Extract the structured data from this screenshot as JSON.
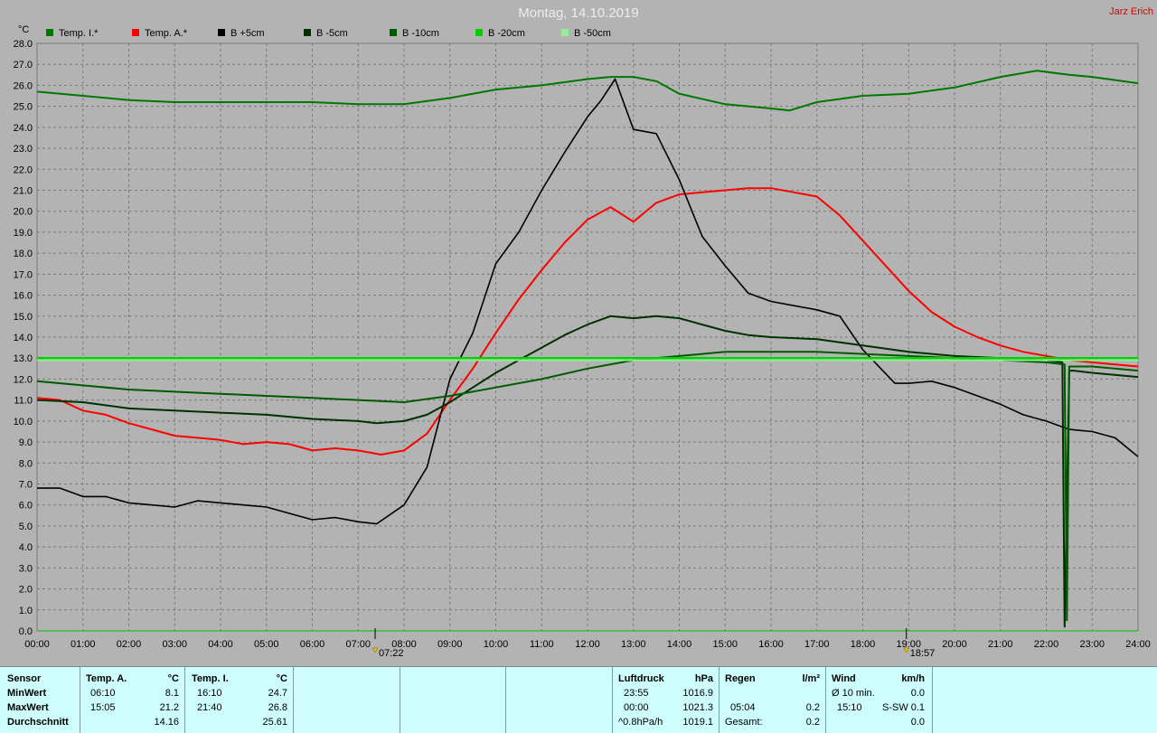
{
  "header": {
    "title": "Montag, 14.10.2019",
    "author": "Jarz Erich"
  },
  "colors": {
    "background": "#b3b3b3",
    "grid": "#7a7a7a",
    "panel": "#cdfdfd"
  },
  "legend": [
    {
      "label": "Temp. I.*",
      "color": "#007800"
    },
    {
      "label": "Temp. A.*",
      "color": "#ff0000"
    },
    {
      "label": "B +5cm",
      "color": "#000000"
    },
    {
      "label": "B -5cm",
      "color": "#003000"
    },
    {
      "label": "B -10cm",
      "color": "#005a00"
    },
    {
      "label": "B -20cm",
      "color": "#00d000"
    },
    {
      "label": "B -50cm",
      "color": "#90f090"
    }
  ],
  "chart_data": {
    "type": "line",
    "title": "Montag, 14.10.2019",
    "ylabel": "°C",
    "ylim": [
      0,
      28
    ],
    "yticks": [
      "0.0",
      "1.0",
      "2.0",
      "3.0",
      "4.0",
      "5.0",
      "6.0",
      "7.0",
      "8.0",
      "9.0",
      "10.0",
      "11.0",
      "12.0",
      "13.0",
      "14.0",
      "15.0",
      "16.0",
      "17.0",
      "18.0",
      "19.0",
      "20.0",
      "21.0",
      "22.0",
      "23.0",
      "24.0",
      "25.0",
      "26.0",
      "27.0",
      "28.0"
    ],
    "xlim": [
      0,
      24
    ],
    "xticks": [
      "00:00",
      "01:00",
      "02:00",
      "03:00",
      "04:00",
      "05:00",
      "06:00",
      "07:00",
      "08:00",
      "09:00",
      "10:00",
      "11:00",
      "12:00",
      "13:00",
      "14:00",
      "15:00",
      "16:00",
      "17:00",
      "18:00",
      "19:00",
      "20:00",
      "21:00",
      "22:00",
      "23:00",
      "24:00"
    ],
    "grid": true,
    "legend_position": "top-left",
    "markers": [
      {
        "x": 7.37,
        "label": "07:22"
      },
      {
        "x": 18.95,
        "label": "18:57"
      }
    ],
    "series": [
      {
        "name": "Temp. I.*",
        "color": "#007800",
        "x": [
          0,
          1,
          2,
          3,
          4,
          5,
          6,
          7,
          8,
          9,
          10,
          11,
          12,
          12.5,
          13,
          13.5,
          14,
          15,
          16,
          16.4,
          17,
          18,
          19,
          20,
          21,
          21.8,
          22.5,
          23,
          24
        ],
        "y": [
          25.7,
          25.5,
          25.3,
          25.2,
          25.2,
          25.2,
          25.2,
          25.1,
          25.1,
          25.4,
          25.8,
          26.0,
          26.3,
          26.4,
          26.4,
          26.2,
          25.6,
          25.1,
          24.9,
          24.8,
          25.2,
          25.5,
          25.6,
          25.9,
          26.4,
          26.7,
          26.5,
          26.4,
          26.1
        ]
      },
      {
        "name": "Temp. A.*",
        "color": "#ff0000",
        "x": [
          0,
          0.5,
          1,
          1.5,
          2,
          2.5,
          3,
          3.5,
          4,
          4.5,
          5,
          5.5,
          6,
          6.5,
          7,
          7.5,
          8,
          8.5,
          9,
          9.5,
          10,
          10.5,
          11,
          11.5,
          12,
          12.5,
          13,
          13.5,
          14,
          14.5,
          15,
          15.5,
          16,
          16.5,
          17,
          17.5,
          18,
          18.5,
          19,
          19.5,
          20,
          20.5,
          21,
          21.5,
          22,
          22.5,
          23,
          23.5,
          24
        ],
        "y": [
          11.1,
          11.0,
          10.5,
          10.3,
          9.9,
          9.6,
          9.3,
          9.2,
          9.1,
          8.9,
          9.0,
          8.9,
          8.6,
          8.7,
          8.6,
          8.4,
          8.6,
          9.4,
          11.0,
          12.5,
          14.2,
          15.8,
          17.2,
          18.5,
          19.6,
          20.2,
          19.5,
          20.4,
          20.8,
          20.9,
          21.0,
          21.1,
          21.1,
          20.9,
          20.7,
          19.8,
          18.6,
          17.4,
          16.2,
          15.2,
          14.5,
          14.0,
          13.6,
          13.3,
          13.1,
          12.9,
          12.8,
          12.7,
          12.6
        ]
      },
      {
        "name": "B +5cm",
        "color": "#000000",
        "x": [
          0,
          0.5,
          1,
          1.5,
          2,
          2.5,
          3,
          3.5,
          4,
          4.5,
          5,
          5.5,
          6,
          6.5,
          7,
          7.4,
          8,
          8.5,
          9,
          9.5,
          10,
          10.5,
          11,
          11.5,
          12,
          12.3,
          12.6,
          13,
          13.5,
          14,
          14.5,
          15,
          15.5,
          16,
          16.5,
          17,
          17.5,
          18,
          18.7,
          19,
          19.5,
          20,
          20.5,
          21,
          21.5,
          22,
          22.5,
          23,
          23.5,
          24
        ],
        "y": [
          6.8,
          6.8,
          6.4,
          6.4,
          6.1,
          6.0,
          5.9,
          6.2,
          6.1,
          6.0,
          5.9,
          5.6,
          5.3,
          5.4,
          5.2,
          5.1,
          6.0,
          7.8,
          12.0,
          14.2,
          17.5,
          19.0,
          21.0,
          22.8,
          24.5,
          25.3,
          26.3,
          23.9,
          23.7,
          21.5,
          18.8,
          17.4,
          16.1,
          15.7,
          15.5,
          15.3,
          15.0,
          13.4,
          11.8,
          11.8,
          11.9,
          11.6,
          11.2,
          10.8,
          10.3,
          10.0,
          9.6,
          9.5,
          9.2,
          8.3
        ]
      },
      {
        "name": "B -5cm",
        "color": "#003000",
        "x": [
          0,
          1,
          2,
          3,
          4,
          5,
          6,
          7,
          7.4,
          8,
          8.5,
          9,
          9.5,
          10,
          10.5,
          11,
          11.5,
          12,
          12.5,
          13,
          13.5,
          14,
          14.5,
          15,
          15.5,
          16,
          17,
          18,
          19,
          20,
          21,
          22,
          22.35,
          22.4,
          22.5,
          22.6,
          23,
          24
        ],
        "y": [
          11.0,
          10.9,
          10.6,
          10.5,
          10.4,
          10.3,
          10.1,
          10.0,
          9.9,
          10.0,
          10.3,
          10.9,
          11.6,
          12.3,
          12.9,
          13.5,
          14.1,
          14.6,
          15.0,
          14.9,
          15.0,
          14.9,
          14.6,
          14.3,
          14.1,
          14.0,
          13.9,
          13.6,
          13.3,
          13.1,
          13.0,
          12.9,
          12.8,
          0.2,
          12.4,
          12.4,
          12.3,
          12.1
        ]
      },
      {
        "name": "B -10cm",
        "color": "#005a00",
        "x": [
          0,
          1,
          2,
          3,
          4,
          5,
          6,
          7,
          8,
          9,
          10,
          11,
          12,
          13,
          14,
          15,
          16,
          17,
          18,
          19,
          20,
          21,
          22,
          22.4,
          22.45,
          22.5,
          23,
          24
        ],
        "y": [
          11.9,
          11.7,
          11.5,
          11.4,
          11.3,
          11.2,
          11.1,
          11.0,
          10.9,
          11.2,
          11.6,
          12.0,
          12.5,
          12.9,
          13.1,
          13.3,
          13.3,
          13.3,
          13.2,
          13.1,
          13.0,
          12.9,
          12.8,
          12.7,
          0.5,
          12.6,
          12.6,
          12.4
        ]
      },
      {
        "name": "B -20cm",
        "color": "#00d000",
        "x": [
          0,
          24
        ],
        "y": [
          13.0,
          13.0
        ]
      },
      {
        "name": "B -50cm",
        "color": "#90f090",
        "x": [
          0,
          24
        ],
        "y": [
          12.9,
          12.9
        ]
      }
    ]
  },
  "stats": {
    "sensor_header": "Sensor",
    "row_min": "MinWert",
    "row_max": "MaxWert",
    "row_avg": "Durchschnitt",
    "temp_a": {
      "header": "Temp. A.",
      "unit": "°C",
      "min_time": "06:10",
      "min_val": "8.1",
      "max_time": "15:05",
      "max_val": "21.2",
      "avg": "14.16"
    },
    "temp_i": {
      "header": "Temp. I.",
      "unit": "°C",
      "min_time": "16:10",
      "min_val": "24.7",
      "max_time": "21:40",
      "max_val": "26.8",
      "avg": "25.61"
    },
    "luftdruck": {
      "header": "Luftdruck",
      "unit": "hPa",
      "r1_time": "23:55",
      "r1_val": "1016.9",
      "r2_time": "00:00",
      "r2_val": "1021.3",
      "r3_label": "^0.8hPa/h",
      "r3_val": "1019.1"
    },
    "regen": {
      "header": "Regen",
      "unit": "l/m²",
      "r1_time": "",
      "r1_val": "",
      "r2_time": "05:04",
      "r2_val": "0.2",
      "r3_label": "Gesamt:",
      "r3_val": "0.2"
    },
    "wind": {
      "header": "Wind",
      "unit": "km/h",
      "r1_label": "Ø 10 min.",
      "r1_val": "0.0",
      "r2_time": "15:10",
      "r2_dir": "S-SW",
      "r2_val": "0.1",
      "r3_val": "0.0"
    }
  }
}
